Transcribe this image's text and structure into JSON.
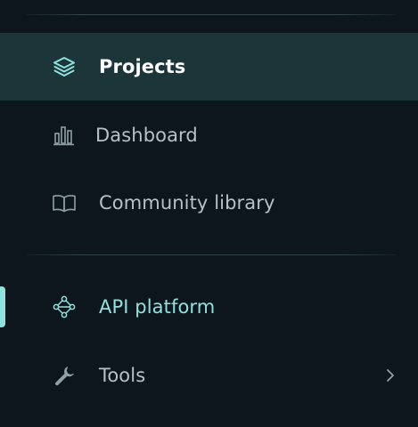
{
  "nav": {
    "items": [
      {
        "label": "Projects",
        "icon": "layers-icon",
        "state": "active"
      },
      {
        "label": "Dashboard",
        "icon": "bar-chart-icon",
        "state": "default"
      },
      {
        "label": "Community library",
        "icon": "book-icon",
        "state": "default"
      },
      {
        "label": "API platform",
        "icon": "api-nodes-icon",
        "state": "highlighted"
      },
      {
        "label": "Tools",
        "icon": "wrench-icon",
        "state": "default",
        "has_submenu": true
      }
    ]
  },
  "colors": {
    "background": "#0d161c",
    "active_background": "#1c3539",
    "accent": "#8ee3de",
    "text_default": "#b6c2c6",
    "text_active": "#ffffff",
    "icon_default": "#8fa0a6"
  }
}
